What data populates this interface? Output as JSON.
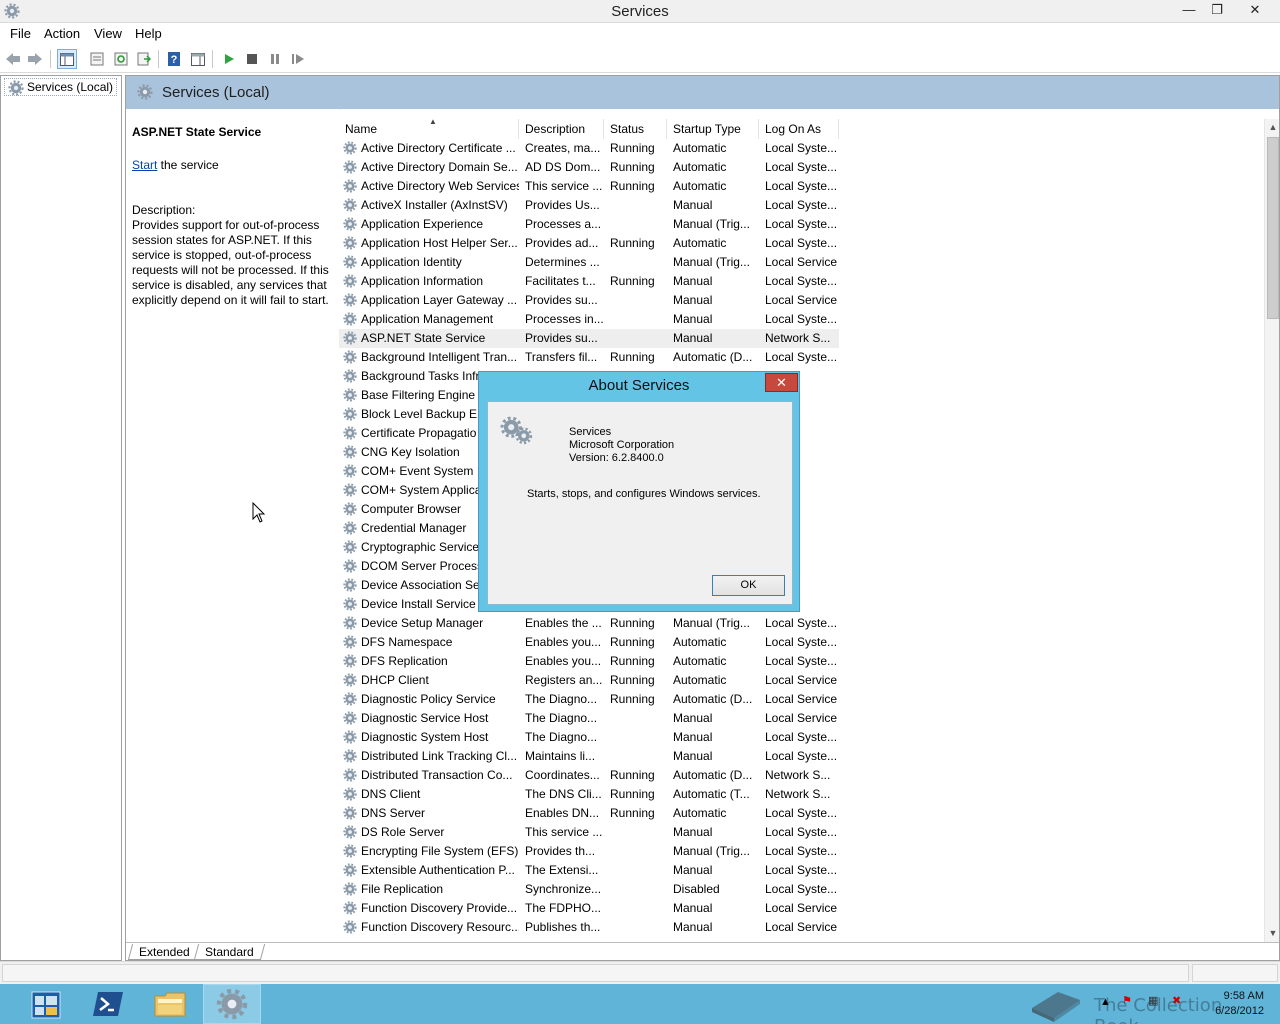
{
  "window": {
    "title": "Services",
    "min_glyph": "—",
    "max_glyph": "❐",
    "close_glyph": "✕"
  },
  "menu": [
    "File",
    "Action",
    "View",
    "Help"
  ],
  "toolbar": {
    "icons": [
      "back-icon",
      "forward-icon",
      "show-hide-console-tree-icon",
      "properties-icon",
      "refresh-icon",
      "export-list-icon",
      "help-icon",
      "show-hide-action-pane-icon",
      "start-service-icon",
      "stop-service-icon",
      "pause-service-icon",
      "restart-service-icon"
    ]
  },
  "tree": {
    "item_label": "Services (Local)"
  },
  "main": {
    "header_title": "Services (Local)",
    "selected_service_name": "ASP.NET State Service",
    "start_link": "Start",
    "start_suffix": " the service",
    "description_label": "Description:",
    "description_text": "Provides support for out-of-process session states for ASP.NET. If this service is stopped, out-of-process requests will not be processed. If this service is disabled, any services that explicitly depend on it will fail to start."
  },
  "columns": [
    "Name",
    "Description",
    "Status",
    "Startup Type",
    "Log On As"
  ],
  "rows": [
    [
      "Active Directory Certificate ...",
      "Creates, ma...",
      "Running",
      "Automatic",
      "Local Syste..."
    ],
    [
      "Active Directory Domain Se...",
      "AD DS Dom...",
      "Running",
      "Automatic",
      "Local Syste..."
    ],
    [
      "Active Directory Web Services",
      "This service ...",
      "Running",
      "Automatic",
      "Local Syste..."
    ],
    [
      "ActiveX Installer (AxInstSV)",
      "Provides Us...",
      "",
      "Manual",
      "Local Syste..."
    ],
    [
      "Application Experience",
      "Processes a...",
      "",
      "Manual (Trig...",
      "Local Syste..."
    ],
    [
      "Application Host Helper Ser...",
      "Provides ad...",
      "Running",
      "Automatic",
      "Local Syste..."
    ],
    [
      "Application Identity",
      "Determines ...",
      "",
      "Manual (Trig...",
      "Local Service"
    ],
    [
      "Application Information",
      "Facilitates t...",
      "Running",
      "Manual",
      "Local Syste..."
    ],
    [
      "Application Layer Gateway ...",
      "Provides su...",
      "",
      "Manual",
      "Local Service"
    ],
    [
      "Application Management",
      "Processes in...",
      "",
      "Manual",
      "Local Syste..."
    ],
    [
      "ASP.NET State Service",
      "Provides su...",
      "",
      "Manual",
      "Network S..."
    ],
    [
      "Background Intelligent Tran...",
      "Transfers fil...",
      "Running",
      "Automatic (D...",
      "Local Syste..."
    ],
    [
      "Background Tasks Infr",
      "",
      "",
      "",
      "yste..."
    ],
    [
      "Base Filtering Engine",
      "",
      "",
      "",
      "ervice"
    ],
    [
      "Block Level Backup En",
      "",
      "",
      "",
      "yste..."
    ],
    [
      "Certificate Propagatio",
      "",
      "",
      "",
      "yste..."
    ],
    [
      "CNG Key Isolation",
      "",
      "",
      "",
      "yste..."
    ],
    [
      "COM+ Event System",
      "",
      "",
      "",
      "ervice"
    ],
    [
      "COM+ System Applica",
      "",
      "",
      "",
      "yste..."
    ],
    [
      "Computer Browser",
      "",
      "",
      "",
      "yste..."
    ],
    [
      "Credential Manager",
      "",
      "",
      "",
      "yste..."
    ],
    [
      "Cryptographic Service",
      "",
      "",
      "",
      "k S..."
    ],
    [
      "DCOM Server Process",
      "",
      "",
      "",
      "yste..."
    ],
    [
      "Device Association Ser",
      "",
      "",
      "",
      "yste..."
    ],
    [
      "Device Install Service",
      "",
      "",
      "",
      "yste..."
    ],
    [
      "Device Setup Manager",
      "Enables the ...",
      "Running",
      "Manual (Trig...",
      "Local Syste..."
    ],
    [
      "DFS Namespace",
      "Enables you...",
      "Running",
      "Automatic",
      "Local Syste..."
    ],
    [
      "DFS Replication",
      "Enables you...",
      "Running",
      "Automatic",
      "Local Syste..."
    ],
    [
      "DHCP Client",
      "Registers an...",
      "Running",
      "Automatic",
      "Local Service"
    ],
    [
      "Diagnostic Policy Service",
      "The Diagno...",
      "Running",
      "Automatic (D...",
      "Local Service"
    ],
    [
      "Diagnostic Service Host",
      "The Diagno...",
      "",
      "Manual",
      "Local Service"
    ],
    [
      "Diagnostic System Host",
      "The Diagno...",
      "",
      "Manual",
      "Local Syste..."
    ],
    [
      "Distributed Link Tracking Cl...",
      "Maintains li...",
      "",
      "Manual",
      "Local Syste..."
    ],
    [
      "Distributed Transaction Co...",
      "Coordinates...",
      "Running",
      "Automatic (D...",
      "Network S..."
    ],
    [
      "DNS Client",
      "The DNS Cli...",
      "Running",
      "Automatic (T...",
      "Network S..."
    ],
    [
      "DNS Server",
      "Enables DN...",
      "Running",
      "Automatic",
      "Local Syste..."
    ],
    [
      "DS Role Server",
      "This service ...",
      "",
      "Manual",
      "Local Syste..."
    ],
    [
      "Encrypting File System (EFS)",
      "Provides th...",
      "",
      "Manual (Trig...",
      "Local Syste..."
    ],
    [
      "Extensible Authentication P...",
      "The Extensi...",
      "",
      "Manual",
      "Local Syste..."
    ],
    [
      "File Replication",
      "Synchronize...",
      "",
      "Disabled",
      "Local Syste..."
    ],
    [
      "Function Discovery Provide...",
      "The FDPHO...",
      "",
      "Manual",
      "Local Service"
    ],
    [
      "Function Discovery Resourc...",
      "Publishes th...",
      "",
      "Manual",
      "Local Service"
    ]
  ],
  "selected_row_index": 10,
  "tabs": [
    "Extended",
    "Standard"
  ],
  "dialog": {
    "title": "About Services",
    "close_glyph": "✕",
    "product": "Services",
    "company": "Microsoft Corporation",
    "version": "Version: 6.2.8400.0",
    "description": "Starts, stops, and configures Windows services.",
    "ok_label": "OK"
  },
  "taskbar": {
    "buttons": [
      "server-manager-icon",
      "powershell-icon",
      "file-explorer-icon",
      "services-icon"
    ],
    "time": "9:58 AM",
    "date": "6/28/2012"
  },
  "watermark": "The Collection Book",
  "colors": {
    "header_blue": "#a9c3dc",
    "dialog_frame": "#63c4e6",
    "taskbar": "#5fb4d8",
    "close_red": "#c7483d"
  }
}
